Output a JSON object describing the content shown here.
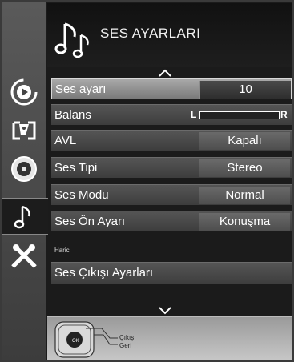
{
  "header": {
    "title": "SES AYARLARI",
    "icon": "music-note-icon"
  },
  "rail": [
    {
      "name": "source-icon",
      "active": false
    },
    {
      "name": "picture-icon",
      "active": false
    },
    {
      "name": "disc-icon",
      "active": false
    },
    {
      "name": "music-note-icon",
      "active": true
    },
    {
      "name": "tools-icon",
      "active": false
    }
  ],
  "menu": {
    "ses_ayari": {
      "label": "Ses ayarı",
      "value": "10"
    },
    "balans": {
      "label": "Balans",
      "left": "L",
      "right": "R",
      "level": 0.5
    },
    "avl": {
      "label": "AVL",
      "value": "Kapalı"
    },
    "ses_tipi": {
      "label": "Ses Tipi",
      "value": "Stereo"
    },
    "ses_modu": {
      "label": "Ses Modu",
      "value": "Normal"
    },
    "ses_on_ayari": {
      "label": "Ses Ön Ayarı",
      "value": "Konuşma"
    }
  },
  "section": {
    "label": "Harici"
  },
  "ses_cikisi": {
    "label": "Ses Çıkışı Ayarları"
  },
  "footer": {
    "ok_label": "OK",
    "exit_label": "Çıkış",
    "back_label": "Geri"
  }
}
